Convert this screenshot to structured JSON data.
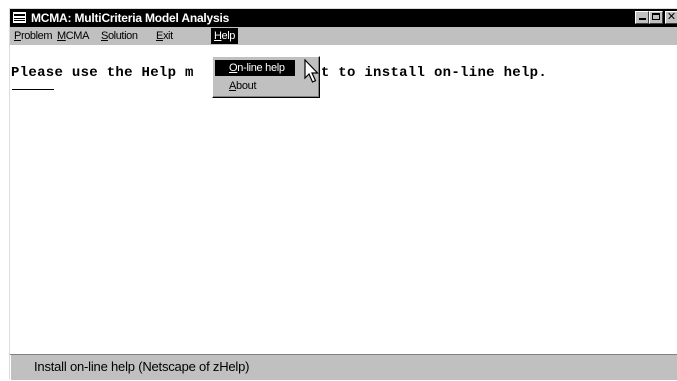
{
  "window": {
    "title": "MCMA: MultiCriteria Model Analysis",
    "controls": {
      "minimize_icon": "minimize-icon",
      "maximize_icon": "maximize-icon",
      "close_icon": "close-icon",
      "close_glyph": "✕"
    }
  },
  "menubar": {
    "items": [
      {
        "label_pre": "",
        "mnemonic": "P",
        "label_post": "roblem"
      },
      {
        "label_pre": "",
        "mnemonic": "M",
        "label_post": "CMA"
      },
      {
        "label_pre": "",
        "mnemonic": "S",
        "label_post": "olution"
      },
      {
        "label_pre": "",
        "mnemonic": "E",
        "label_post": "xit"
      },
      {
        "label_pre": "",
        "mnemonic": "H",
        "label_post": "elp"
      }
    ]
  },
  "main": {
    "message_left": "Please use the Help m",
    "message_right": "want to install on-line help."
  },
  "help_menu": {
    "items": [
      {
        "mnemonic": "O",
        "label_post": "n-line help",
        "selected": true
      },
      {
        "mnemonic": "A",
        "label_post": "bout",
        "selected": false
      }
    ]
  },
  "status": {
    "text": "Install on-line help (Netscape of zHelp)"
  },
  "colors": {
    "titlebar_bg": "#000000",
    "face": "#c0c0c0",
    "highlight": "#000000",
    "client_bg": "#ffffff"
  }
}
